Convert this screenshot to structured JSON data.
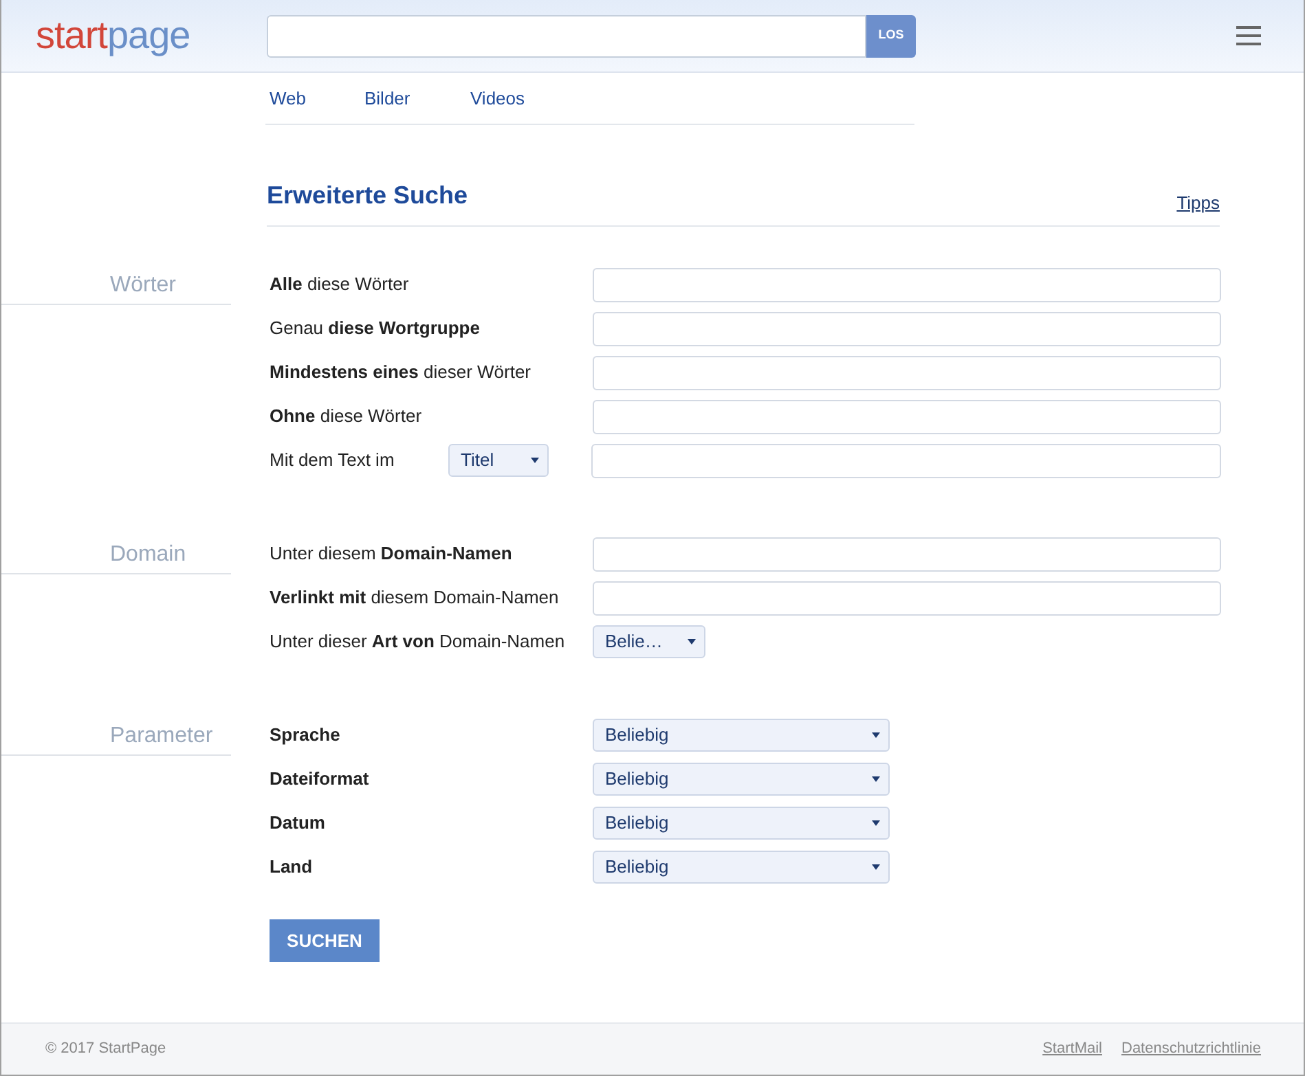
{
  "header": {
    "logo": {
      "first": "start",
      "second": "page"
    },
    "search_button": "LOS"
  },
  "tabs": [
    "Web",
    "Bilder",
    "Videos"
  ],
  "title": "Erweiterte Suche",
  "tips_link": "Tipps",
  "sections": [
    {
      "title": "Wörter",
      "rows": [
        {
          "kind": "input",
          "label": "**Alle** diese Wörter"
        },
        {
          "kind": "input",
          "label": "Genau **diese Wortgruppe**"
        },
        {
          "kind": "input",
          "label": "**Mindestens eines** dieser Wörter"
        },
        {
          "kind": "input",
          "label": "**Ohne** diese Wörter"
        },
        {
          "kind": "select_input",
          "label": "Mit dem Text im",
          "select": "Titel"
        }
      ]
    },
    {
      "title": "Domain",
      "rows": [
        {
          "kind": "input",
          "label": "Unter diesem **Domain-Namen**"
        },
        {
          "kind": "input",
          "label": "**Verlinkt mit** diesem Domain-Namen"
        },
        {
          "kind": "select_small",
          "label": "Unter dieser **Art von** Domain-Namen",
          "select": "Belie…"
        }
      ]
    },
    {
      "title": "Parameter",
      "rows": [
        {
          "kind": "select_wide",
          "label": "Sprache",
          "select": "Beliebig"
        },
        {
          "kind": "select_wide",
          "label": "Dateiformat",
          "select": "Beliebig"
        },
        {
          "kind": "select_wide",
          "label": "Datum",
          "select": "Beliebig"
        },
        {
          "kind": "select_wide",
          "label": "Land",
          "select": "Beliebig"
        }
      ]
    }
  ],
  "submit": "SUCHEN",
  "footer": {
    "copyright": "© 2017 StartPage",
    "links": [
      "StartMail",
      "Datenschutzrichtlinie"
    ]
  }
}
